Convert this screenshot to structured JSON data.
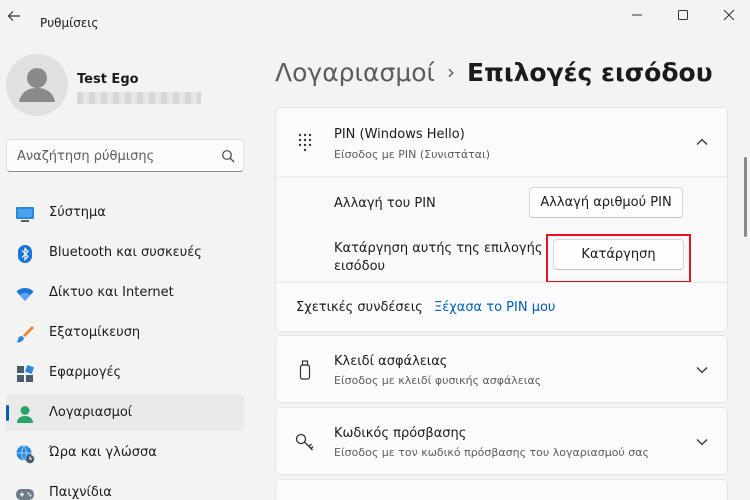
{
  "app": {
    "title": "Ρυθμίσεις"
  },
  "user": {
    "name": "Test Ego"
  },
  "search": {
    "placeholder": "Αναζήτηση ρύθμισης"
  },
  "nav": {
    "items": [
      {
        "label": "Σύστημα",
        "icon": "system-icon"
      },
      {
        "label": "Bluetooth και συσκευές",
        "icon": "bluetooth-icon"
      },
      {
        "label": "Δίκτυο και Internet",
        "icon": "wifi-icon"
      },
      {
        "label": "Εξατομίκευση",
        "icon": "brush-icon"
      },
      {
        "label": "Εφαρμογές",
        "icon": "apps-icon"
      },
      {
        "label": "Λογαριασμοί",
        "icon": "accounts-icon",
        "active": true
      },
      {
        "label": "Ώρα και γλώσσα",
        "icon": "globe-clock-icon"
      },
      {
        "label": "Παιχνίδια",
        "icon": "gamepad-icon"
      }
    ]
  },
  "breadcrumb": {
    "parent": "Λογαριασμοί",
    "separator": "›",
    "current": "Επιλογές εισόδου"
  },
  "pin_card": {
    "title": "PIN (Windows Hello)",
    "subtitle": "Είσοδος με PIN (Συνιστάται)",
    "change_label": "Αλλαγή του PIN",
    "change_button": "Αλλαγή αριθμού PIN",
    "remove_label_line1": "Κατάργηση αυτής της επιλογής",
    "remove_label_line2": "εισόδου",
    "remove_button": "Κατάργηση",
    "related_label": "Σχετικές συνδέσεις",
    "related_link": "Ξέχασα το PIN μου"
  },
  "security_key_card": {
    "title": "Κλειδί ασφάλειας",
    "subtitle": "Είσοδος με κλειδί φυσικής ασφάλειας"
  },
  "password_card": {
    "title": "Κωδικός πρόσβασης",
    "subtitle": "Είσοδος με τον κωδικό πρόσβασης του λογαριασμού σας"
  },
  "colors": {
    "accent": "#005fb8",
    "highlight": "#e81123"
  }
}
